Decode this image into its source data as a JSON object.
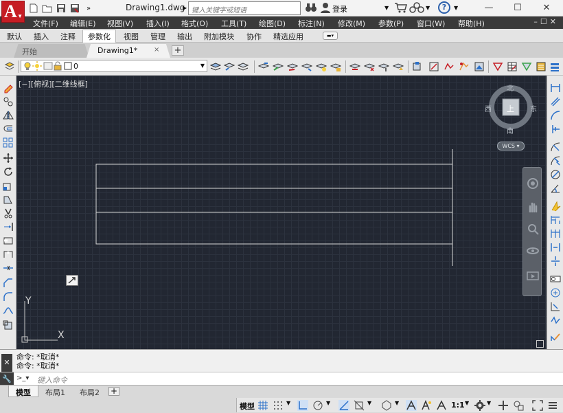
{
  "app": {
    "logo_letter": "A",
    "document_title": "Drawing1.dwg",
    "search_placeholder": "键入关键字或短语",
    "login_label": "登录",
    "help_label": "?"
  },
  "menu": {
    "items": [
      "文件(F)",
      "编辑(E)",
      "视图(V)",
      "插入(I)",
      "格式(O)",
      "工具(T)",
      "绘图(D)",
      "标注(N)",
      "修改(M)",
      "参数(P)",
      "窗口(W)",
      "帮助(H)"
    ]
  },
  "ribbon": {
    "tabs": [
      "默认",
      "插入",
      "注释",
      "参数化",
      "视图",
      "管理",
      "输出",
      "附加模块",
      "协作",
      "精选应用"
    ],
    "active_tab": "参数化"
  },
  "file_tabs": {
    "start_label": "开始",
    "drawing_label": "Drawing1*",
    "close_glyph": "×",
    "add_glyph": "+"
  },
  "layers": {
    "current_layer": "0"
  },
  "viewport": {
    "label": "[−][俯视][二维线框]"
  },
  "viewcube": {
    "north": "北",
    "south": "南",
    "east": "东",
    "west": "西",
    "face": "上",
    "coordinate_system": "WCS"
  },
  "ucs_icon": {
    "x_label": "X",
    "y_label": "Y"
  },
  "command": {
    "history": [
      "命令: *取消*",
      "命令: *取消*"
    ],
    "input_placeholder": "键入命令",
    "prompt_glyph": ">_▾"
  },
  "layout_tabs": {
    "items": [
      "模型",
      "布局1",
      "布局2"
    ],
    "active": "模型",
    "add_glyph": "+"
  },
  "status_bar": {
    "model_label": "模型",
    "annotation_scale": "1:1"
  },
  "colors": {
    "canvas_bg": "#222732",
    "drawing_lines": "#d8d8d8",
    "menu_bg": "#3a3a3a",
    "logo_red": "#c61d24"
  }
}
